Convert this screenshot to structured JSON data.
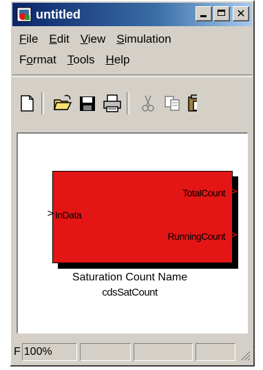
{
  "window": {
    "title": "untitled"
  },
  "menubar": {
    "row1": [
      {
        "label": "File",
        "accel": "F",
        "rest": "ile"
      },
      {
        "label": "Edit",
        "accel": "E",
        "rest": "dit"
      },
      {
        "label": "View",
        "accel": "V",
        "rest": "iew"
      },
      {
        "label": "Simulation",
        "accel": "S",
        "rest": "imulation"
      }
    ],
    "row2": [
      {
        "label": "Format",
        "accel": "o",
        "pre": "F",
        "rest": "rmat"
      },
      {
        "label": "Tools",
        "accel": "T",
        "rest": "ools"
      },
      {
        "label": "Help",
        "accel": "H",
        "rest": "elp"
      }
    ]
  },
  "toolbar": {
    "buttons": [
      "new-icon",
      "open-icon",
      "save-icon",
      "print-icon",
      "cut-icon",
      "copy-icon",
      "paste-icon"
    ]
  },
  "block": {
    "color": "#e41515",
    "input_port": "InData",
    "output_port_1": "TotalCount",
    "output_port_2": "RunningCount",
    "name": "Saturation Count Name",
    "subtitle": "cdsSatCount"
  },
  "statusbar": {
    "prefix": "F",
    "zoom": "100%"
  }
}
